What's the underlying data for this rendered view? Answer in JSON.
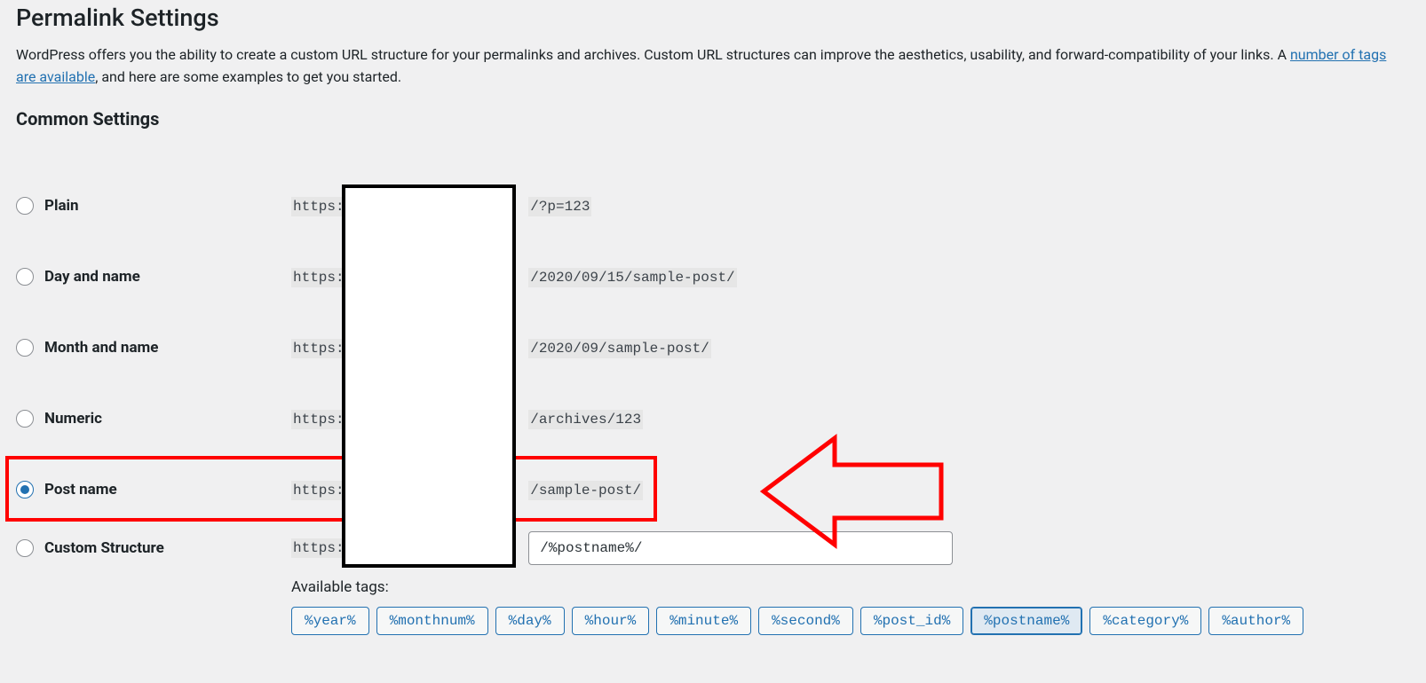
{
  "page_title": "Permalink Settings",
  "intro_pre": "WordPress offers you the ability to create a custom URL structure for your permalinks and archives. Custom URL structures can improve the aesthetics, usability, and forward-compatibility of your links. A ",
  "intro_link": "number of tags are available",
  "intro_post": ", and here are some examples to get you started.",
  "section_title": "Common Settings",
  "url_prefix": "https:/",
  "options": [
    {
      "label": "Plain",
      "suffix": "/?p=123",
      "checked": false
    },
    {
      "label": "Day and name",
      "suffix": "/2020/09/15/sample-post/",
      "checked": false
    },
    {
      "label": "Month and name",
      "suffix": "/2020/09/sample-post/",
      "checked": false
    },
    {
      "label": "Numeric",
      "suffix": "/archives/123",
      "checked": false
    },
    {
      "label": "Post name",
      "suffix": "/sample-post/",
      "checked": true
    }
  ],
  "custom_label": "Custom Structure",
  "custom_value": "/%postname%/",
  "available_tags_label": "Available tags:",
  "tags": [
    "%year%",
    "%monthnum%",
    "%day%",
    "%hour%",
    "%minute%",
    "%second%",
    "%post_id%",
    "%postname%",
    "%category%",
    "%author%"
  ],
  "active_tag_index": 7
}
